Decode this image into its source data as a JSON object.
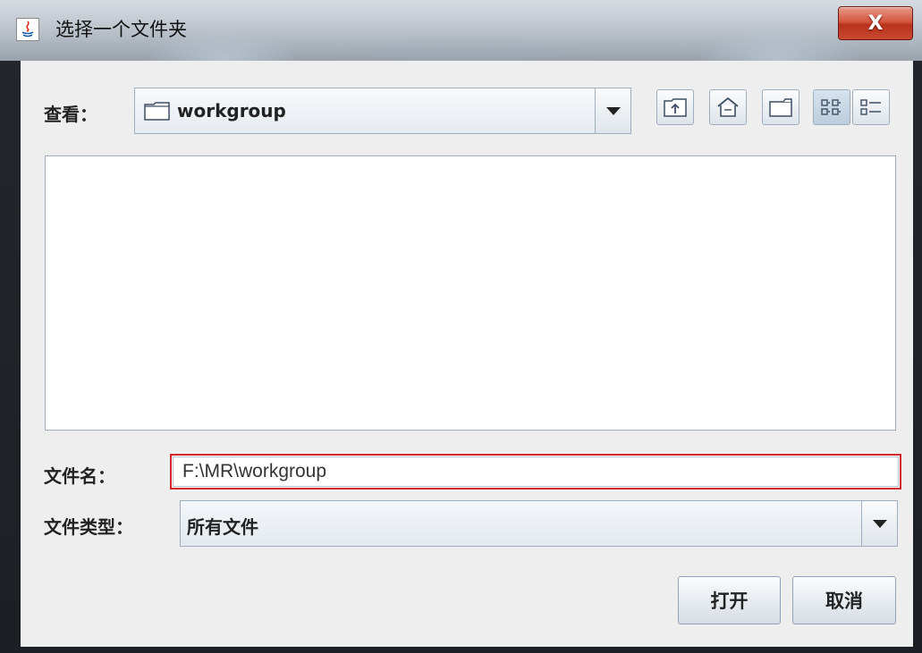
{
  "window": {
    "title": "选择一个文件夹",
    "close_label": "X"
  },
  "look_in": {
    "label": "查看：",
    "value": "workgroup",
    "toolbar": [
      {
        "name": "up-one-level-button",
        "icon": "up-folder-icon"
      },
      {
        "name": "home-button",
        "icon": "home-icon"
      },
      {
        "name": "new-folder-button",
        "icon": "new-folder-icon"
      },
      {
        "name": "list-view-button",
        "icon": "list-view-icon",
        "selected": true
      },
      {
        "name": "details-view-button",
        "icon": "details-view-icon",
        "selected": false
      }
    ]
  },
  "file_list": {
    "items": []
  },
  "file_name": {
    "label": "文件名：",
    "value": "F:\\MR\\workgroup"
  },
  "file_type": {
    "label": "文件类型：",
    "value": "所有文件"
  },
  "buttons": {
    "open": "打开",
    "cancel": "取消"
  }
}
